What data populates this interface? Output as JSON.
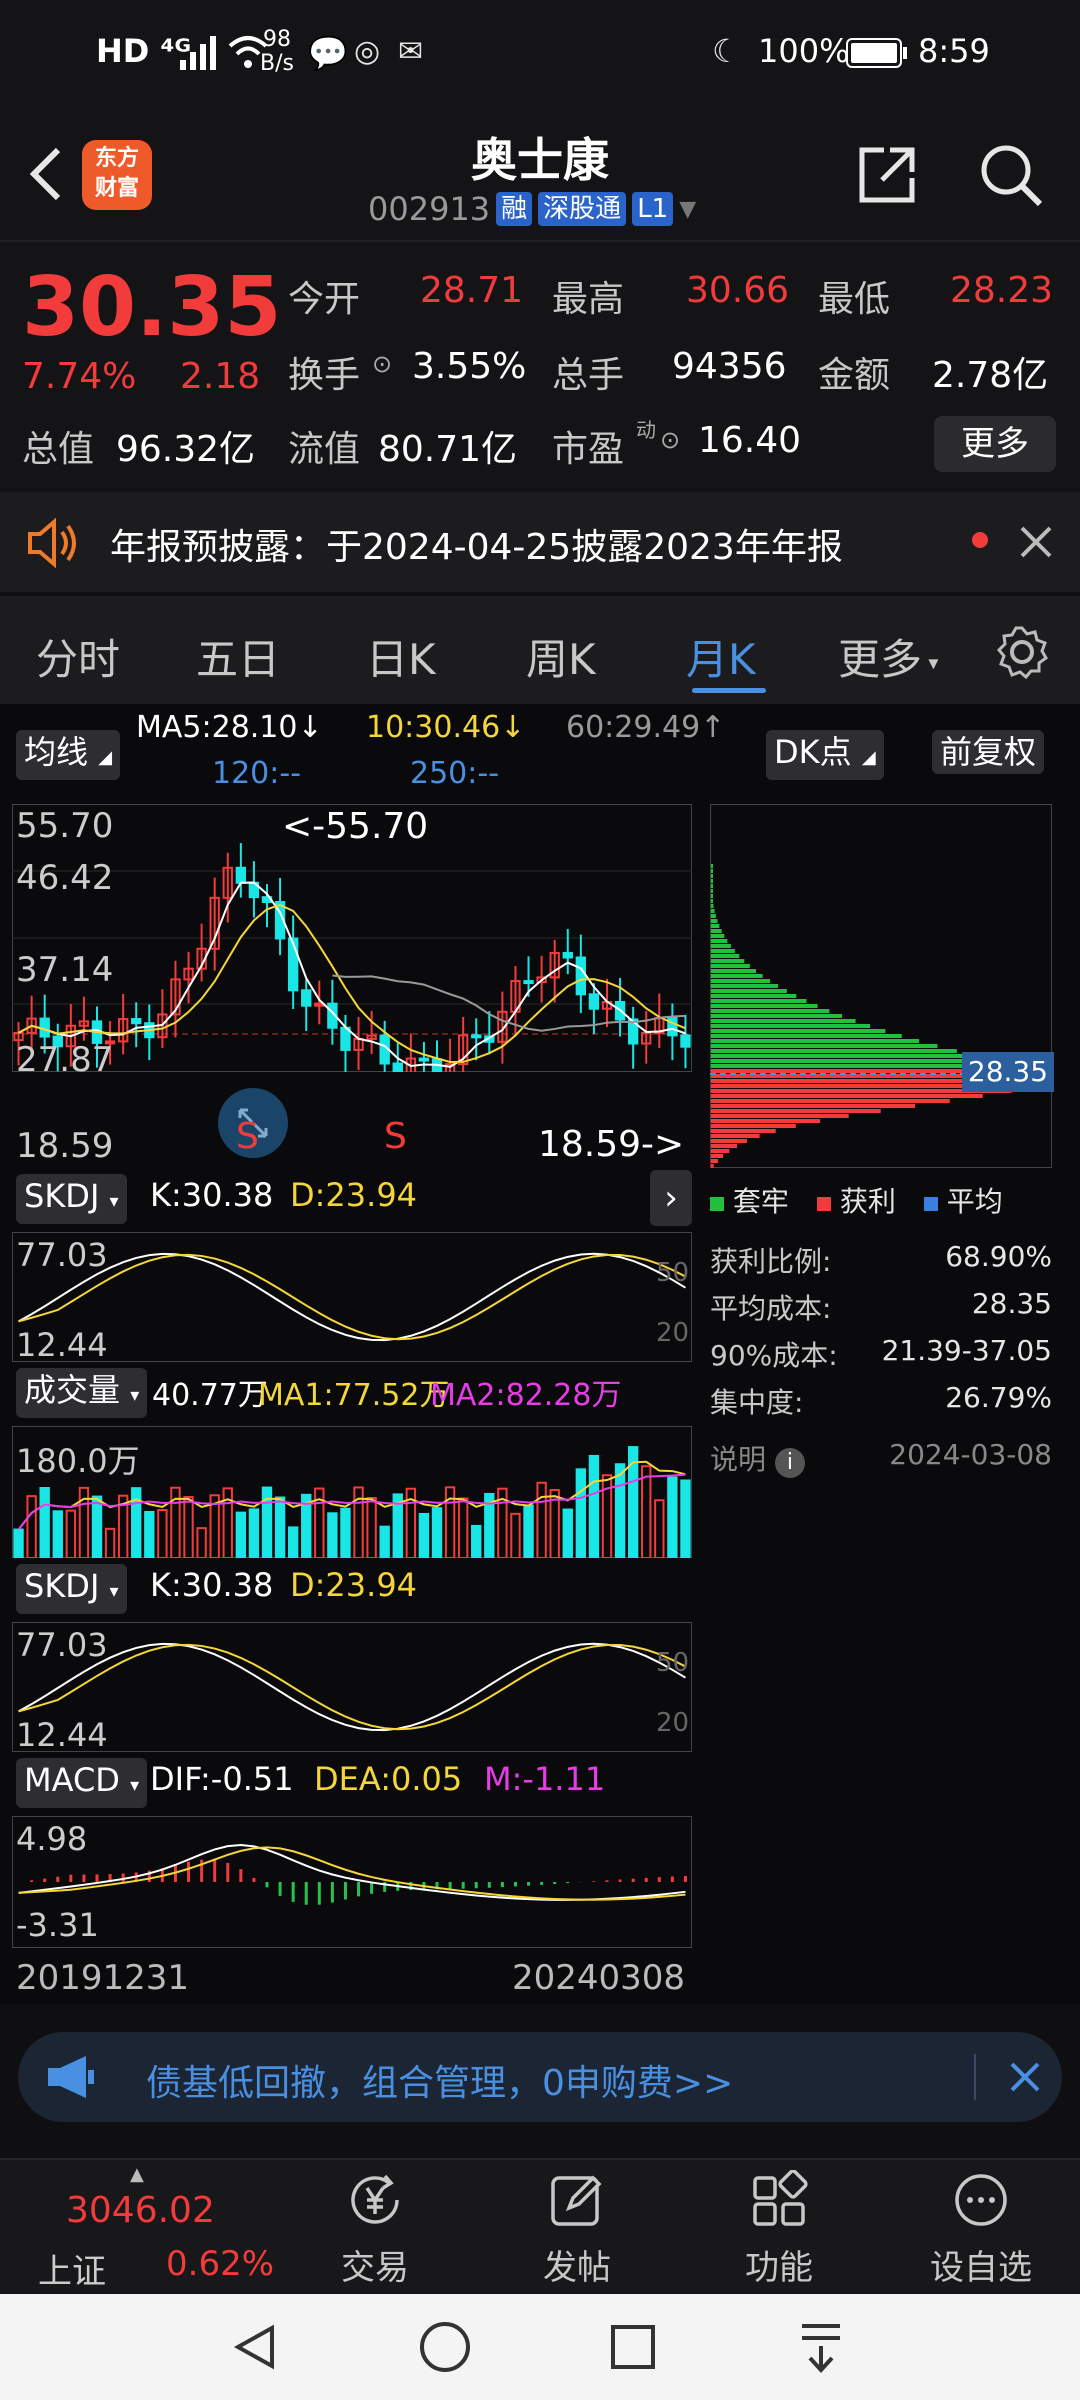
{
  "status_bar": {
    "left_icons": "HD ⁴ᴳ",
    "net_speed_top": "98",
    "net_speed_bottom": "B/s",
    "battery": "100%",
    "time": "8:59"
  },
  "header": {
    "logo_line1": "东方",
    "logo_line2": "财富",
    "name": "奥士康",
    "code": "002913",
    "tags": [
      "融",
      "深股通",
      "L1"
    ]
  },
  "quote": {
    "price": "30.35",
    "change_pct": "7.74%",
    "change": "2.18",
    "fields": [
      {
        "label": "今开",
        "value": "28.71"
      },
      {
        "label": "最高",
        "value": "30.66"
      },
      {
        "label": "最低",
        "value": "28.23"
      },
      {
        "label": "换手",
        "value": "3.55%"
      },
      {
        "label": "总手",
        "value": "94356"
      },
      {
        "label": "金额",
        "value": "2.78亿"
      },
      {
        "label": "总值",
        "value": "96.32亿"
      },
      {
        "label": "流值",
        "value": "80.71亿"
      },
      {
        "label": "市盈",
        "value": "16.40"
      }
    ],
    "pe_superscript": "动",
    "more_label": "更多"
  },
  "notice": {
    "text": "年报预披露：于2024-04-25披露2023年年报"
  },
  "tabs": [
    {
      "label": "分时",
      "active": false
    },
    {
      "label": "五日",
      "active": false
    },
    {
      "label": "日K",
      "active": false
    },
    {
      "label": "周K",
      "active": false
    },
    {
      "label": "月K",
      "active": true
    },
    {
      "label": "更多",
      "active": false
    }
  ],
  "chart": {
    "ma_button": "均线",
    "ma5": "MA5:28.10↓",
    "ma10": "10:30.46↓",
    "ma60": "60:29.49↑",
    "ma120": "120:--",
    "ma250": "250:--",
    "dk_button": "DK点",
    "adjust_button": "前复权",
    "price_max_label": "55.70",
    "price_level_2": "46.42",
    "price_level_3": "37.14",
    "price_level_4": "27.87",
    "price_min_label": "18.59",
    "high_marker": "<-55.70",
    "low_marker": "18.59->",
    "signal_s": "S",
    "chip_price": "28.35",
    "chip_legend": [
      "套牢",
      "获利",
      "平均"
    ],
    "chip_stats": [
      {
        "label": "获利比例:",
        "value": "68.90%"
      },
      {
        "label": "平均成本:",
        "value": "28.35"
      },
      {
        "label": "90%成本:",
        "value": "21.39-37.05"
      },
      {
        "label": "集中度:",
        "value": "26.79%"
      }
    ],
    "chip_note_label": "说明",
    "chip_date": "2024-03-08",
    "skdj_button": "SKDJ",
    "skdj_k": "K:30.38",
    "skdj_d": "D:23.94",
    "skdj_top": "77.03",
    "skdj_bottom": "12.44",
    "skdj_mid50": "50",
    "skdj_mid20": "20",
    "vol_button": "成交量",
    "vol_value": "40.77万",
    "vol_ma1": "MA1:77.52万",
    "vol_ma2": "MA2:82.28万",
    "vol_top": "180.0万",
    "macd_button": "MACD",
    "macd_dif": "DIF:-0.51",
    "macd_dea": "DEA:0.05",
    "macd_m": "M:-1.11",
    "macd_top": "4.98",
    "macd_bottom": "-3.31",
    "date_start": "20191231",
    "date_end": "20240308"
  },
  "promo": {
    "text": "债基低回撤，组合管理，0申购费>>"
  },
  "bottom_bar": {
    "index_value": "3046.02",
    "index_name": "上证",
    "index_change": "0.62%",
    "items": [
      "交易",
      "发帖",
      "功能",
      "设自选"
    ]
  },
  "colors": {
    "up": "#f23b3b",
    "down": "#19e6e6",
    "accent": "#4a90e2",
    "background": "#0a0a0c"
  }
}
